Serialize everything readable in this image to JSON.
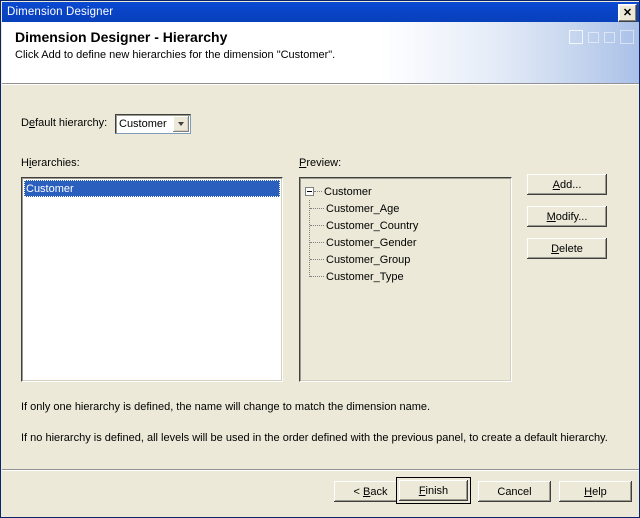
{
  "window": {
    "title": "Dimension Designer",
    "close_label": "✕"
  },
  "header": {
    "title": "Dimension Designer - Hierarchy",
    "subtitle": "Click Add to define new hierarchies for the dimension \"Customer\"."
  },
  "default_hierarchy": {
    "label_pre": "D",
    "label_acc": "e",
    "label_post": "fault hierarchy:",
    "value": "Customer",
    "options": [
      "Customer"
    ]
  },
  "hierarchies": {
    "label_pre": "H",
    "label_acc": "i",
    "label_post": "erarchies:",
    "items": [
      "Customer"
    ],
    "selected": "Customer"
  },
  "preview": {
    "label_acc": "P",
    "label_post": "review:",
    "tree": {
      "root": "Customer",
      "expanded": true,
      "children": [
        "Customer_Age",
        "Customer_Country",
        "Customer_Gender",
        "Customer_Group",
        "Customer_Type"
      ]
    }
  },
  "side_buttons": {
    "add": {
      "acc": "A",
      "rest": "dd..."
    },
    "modify": {
      "acc": "M",
      "rest": "odify..."
    },
    "delete": {
      "acc": "D",
      "rest": "elete"
    }
  },
  "notes": {
    "line1": "If only one hierarchy is defined, the name will change to match the dimension name.",
    "line2": "If no hierarchy is defined, all levels will be used in the order defined with the previous panel, to create a default hierarchy."
  },
  "footer_buttons": {
    "back": {
      "pre": "< ",
      "acc": "B",
      "rest": "ack"
    },
    "finish": {
      "acc": "F",
      "rest": "inish"
    },
    "cancel": {
      "acc": "",
      "rest": "Cancel"
    },
    "help": {
      "acc": "H",
      "rest": "elp"
    }
  },
  "colors": {
    "dialog": "#ECE9D8",
    "titlebar": "#0A44C8",
    "selection": "#2A5FBE",
    "field": "#FFFFFF"
  }
}
